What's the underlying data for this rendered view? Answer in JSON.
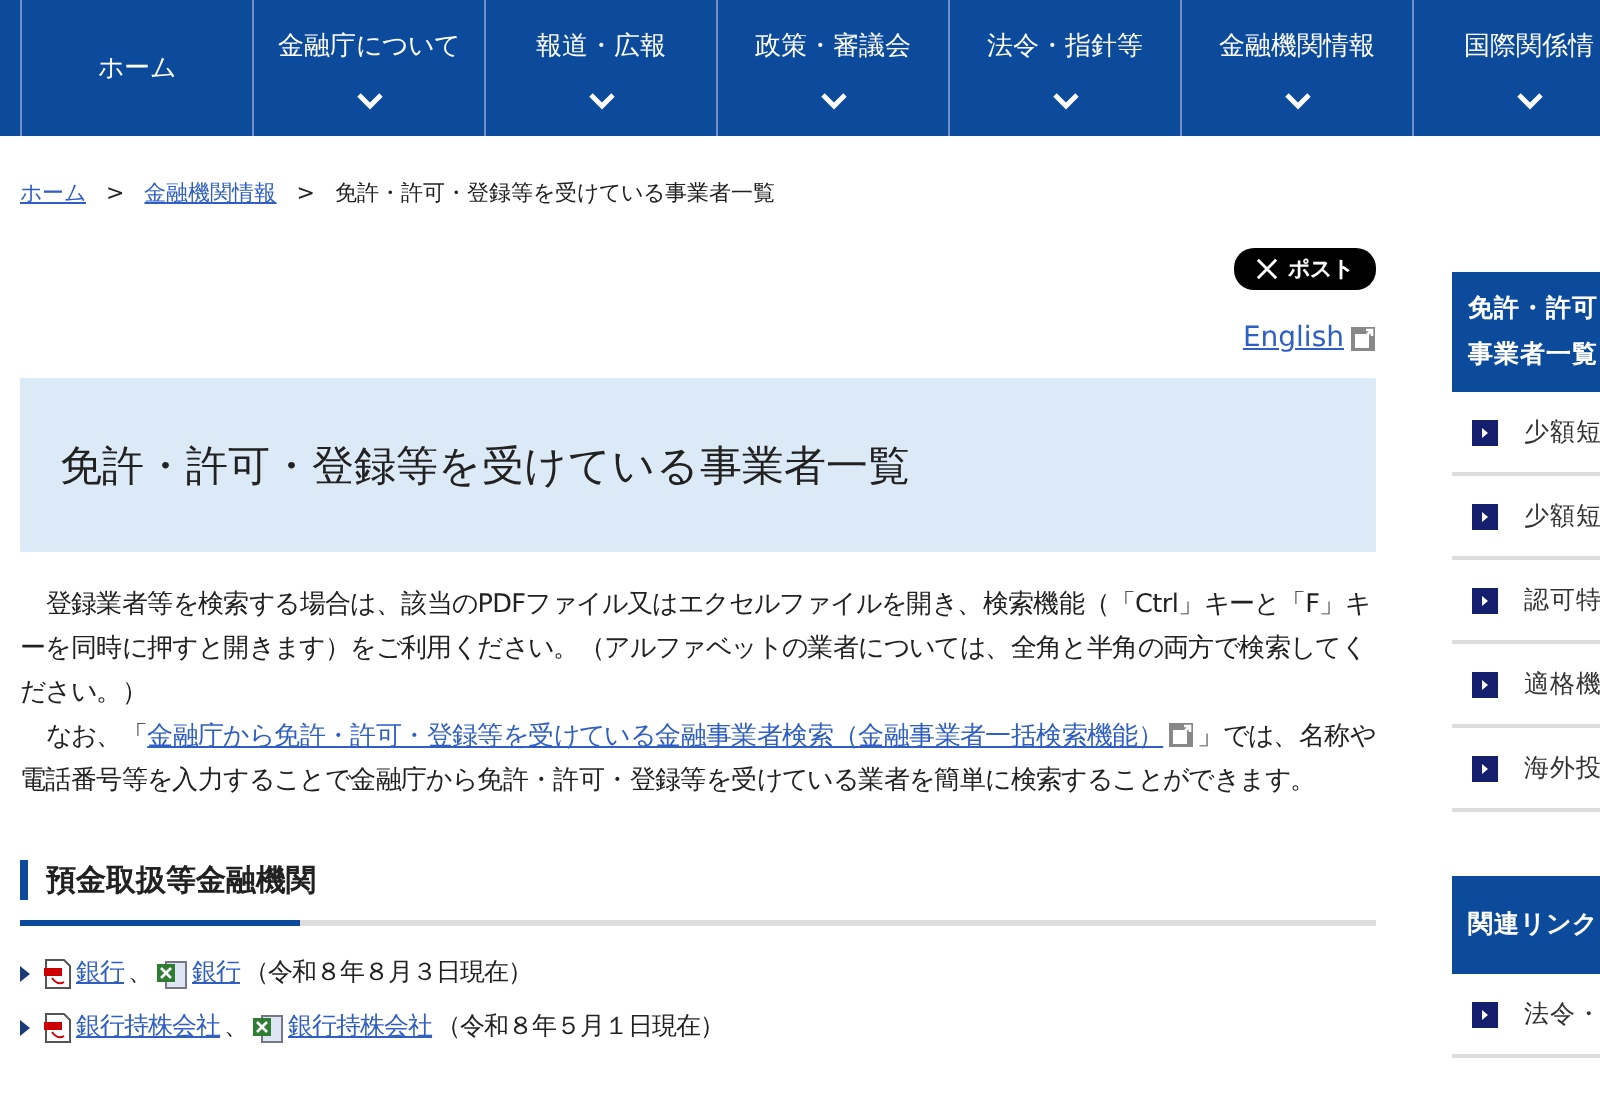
{
  "nav": [
    {
      "label": "ホーム",
      "dropdown": false
    },
    {
      "label": "金融庁について",
      "dropdown": true
    },
    {
      "label": "報道・広報",
      "dropdown": true
    },
    {
      "label": "政策・審議会",
      "dropdown": true
    },
    {
      "label": "法令・指針等",
      "dropdown": true
    },
    {
      "label": "金融機関情報",
      "dropdown": true
    },
    {
      "label": "国際関係情",
      "dropdown": true
    }
  ],
  "breadcrumb_separator": ">",
  "breadcrumb": [
    {
      "label": "ホーム",
      "link": true
    },
    {
      "label": "金融機関情報",
      "link": true
    },
    {
      "label": "免許・許可・登録等を受けている事業者一覧",
      "link": false
    }
  ],
  "post_button": "ポスト",
  "english_link": "English",
  "page_title": "免許・許可・登録等を受けている事業者一覧",
  "intro": {
    "paragraph_1": "登録業者等を検索する場合は、該当のPDFファイル又はエクセルファイルを開き、検索機能（「Ctrl」キーと「F」キーを同時に押すと開きます）をご利用ください。（アルファベットの業者については、全角と半角の両方で検索してください。）",
    "paragraph_2_before": "なお、「",
    "paragraph_2_link": "金融庁から免許・許可・登録等を受けている金融事業者検索（金融事業者一括検索機能）",
    "paragraph_2_after": "」では、名称や電話番号等を入力することで金融庁から免許・許可・登録等を受けている業者を簡単に検索することができます。"
  },
  "section": {
    "heading": "預金取扱等金融機関",
    "items": [
      {
        "links": [
          {
            "kind": "pdf",
            "label": "銀行"
          },
          {
            "kind": "excel",
            "label": "銀行"
          }
        ],
        "separator": "、",
        "note": "（令和８年８月３日現在）"
      },
      {
        "links": [
          {
            "kind": "pdf",
            "label": "銀行持株会社"
          },
          {
            "kind": "excel",
            "label": "銀行持株会社"
          }
        ],
        "separator": "、",
        "note": "（令和８年５月１日現在）"
      }
    ]
  },
  "sidebar": {
    "heading_lines": [
      "免許・許可",
      "事業者一覧"
    ],
    "items": [
      "少額短",
      "少額短",
      "認可特",
      "適格機",
      "海外投"
    ],
    "related_heading": "関連リンク",
    "related_items": [
      "法令・"
    ]
  }
}
